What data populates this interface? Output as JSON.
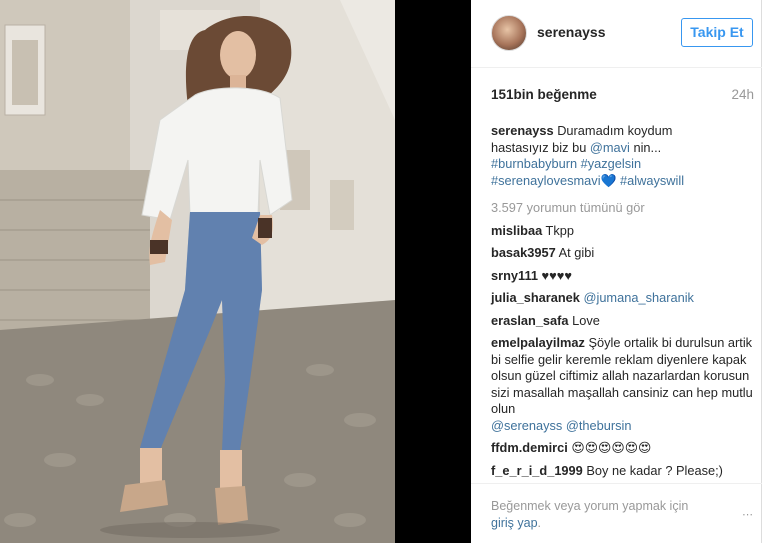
{
  "post": {
    "username": "serenayss",
    "follow_label": "Takip Et",
    "likes": "151bin beğenme",
    "time": "24h"
  },
  "caption": {
    "user": "serenayss",
    "text_1": "Duramadım koydum",
    "text_2": "hastasıyız biz bu",
    "mention": "@mavi",
    "text_3": "nin...",
    "tags_line1": "#burnbabyburn #yazgelsin",
    "tags_line2a": "#serenaylovesmavi",
    "heart": "💙",
    "tags_line2b": "#alwayswill"
  },
  "view_all_comments": "3.597 yorumun tümünü gör",
  "comments": [
    {
      "user": "mislibaa",
      "text": "Tkpp"
    },
    {
      "user": "basak3957",
      "text": "At gibi"
    },
    {
      "user": "srny111",
      "text": "♥♥♥♥"
    },
    {
      "user": "julia_sharanek",
      "text": "@jumana_sharanik"
    },
    {
      "user": "eraslan_safa",
      "text": "Love"
    },
    {
      "user": "emelpalayilmaz",
      "text": "Şöyle ortalik bi durulsun artik bi selfie gelir keremle reklam diyenlere kapak olsun güzel ciftimiz allah nazarlardan korusun sizi masallah maşallah cansiniz can hep mutlu olun",
      "mentions": "@serenayss @thebursin"
    },
    {
      "user": "ffdm.demirci",
      "text": "😍😍😍😍😍😍"
    },
    {
      "user": "f_e_r_i_d_1999",
      "text": "Boy ne kadar ? Please;)"
    }
  ],
  "footer": {
    "text": "Beğenmek veya yorum yapmak için",
    "login": "giriş yap",
    "period": ".",
    "more_icon": "⋯"
  },
  "colors": {
    "link": "#3f729b",
    "follow": "#3897f0",
    "muted": "#999999"
  }
}
